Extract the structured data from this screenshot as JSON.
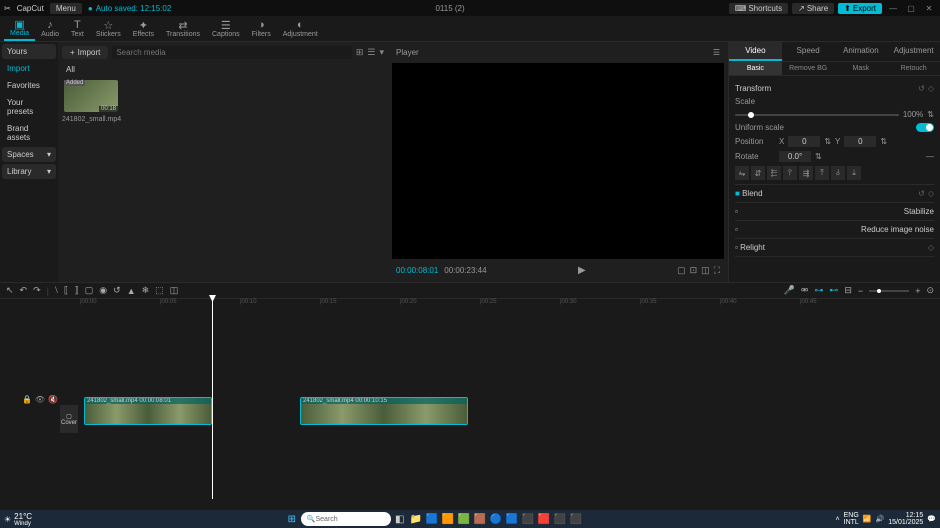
{
  "titlebar": {
    "app": "CapCut",
    "menu": "Menu",
    "autosave": "Auto saved: 12:15:02",
    "project": "0115 (2)",
    "shortcuts": "Shortcuts",
    "share": "Share",
    "export": "Export"
  },
  "toolbar": {
    "items": [
      {
        "label": "Media",
        "icon": "▣"
      },
      {
        "label": "Audio",
        "icon": "♪"
      },
      {
        "label": "Text",
        "icon": "T"
      },
      {
        "label": "Stickers",
        "icon": "☆"
      },
      {
        "label": "Effects",
        "icon": "✦"
      },
      {
        "label": "Transitions",
        "icon": "⇄"
      },
      {
        "label": "Captions",
        "icon": "☰"
      },
      {
        "label": "Filters",
        "icon": "◑"
      },
      {
        "label": "Adjustment",
        "icon": "◐"
      }
    ]
  },
  "sidebar": {
    "yours": "Yours",
    "import": "Import",
    "favorites": "Favorites",
    "presets": "Your presets",
    "brand": "Brand assets",
    "spaces": "Spaces",
    "library": "Library"
  },
  "media": {
    "import_btn": "Import",
    "search_placeholder": "Search media",
    "all": "All",
    "thumb_badge": "Added",
    "thumb_dur": "00:18",
    "thumb_name": "241802_small.mp4"
  },
  "player": {
    "title": "Player",
    "time_current": "00:00:08:01",
    "time_total": "00:00:23:44"
  },
  "props": {
    "tabs": [
      "Video",
      "Speed",
      "Animation",
      "Adjustment"
    ],
    "subtabs": [
      "Basic",
      "Remove BG",
      "Mask",
      "Retouch"
    ],
    "transform": "Transform",
    "scale": "Scale",
    "scale_val": "100%",
    "uniform": "Uniform scale",
    "position": "Position",
    "pos_x": "0",
    "pos_y": "0",
    "rotate": "Rotate",
    "rotate_val": "0.0°",
    "blend": "Blend",
    "stabilize": "Stabilize",
    "noise": "Reduce image noise",
    "relight": "Relight"
  },
  "timeline": {
    "marks": [
      "|00:00",
      "|00:05",
      "|00:10",
      "|00:15",
      "|00:20",
      "|00:25",
      "|00:30",
      "|00:35",
      "|00:40",
      "|00:45"
    ],
    "cover": "Cover",
    "clip1_label": "241802_small.mp4  00:00:08:01",
    "clip2_label": "241802_small.mp4  00:00:10:15"
  },
  "taskbar": {
    "temp": "21°C",
    "weather": "Windy",
    "search": "Search",
    "lang": "ENG",
    "intl": "INTL",
    "time": "12:15",
    "date": "15/01/2025"
  }
}
